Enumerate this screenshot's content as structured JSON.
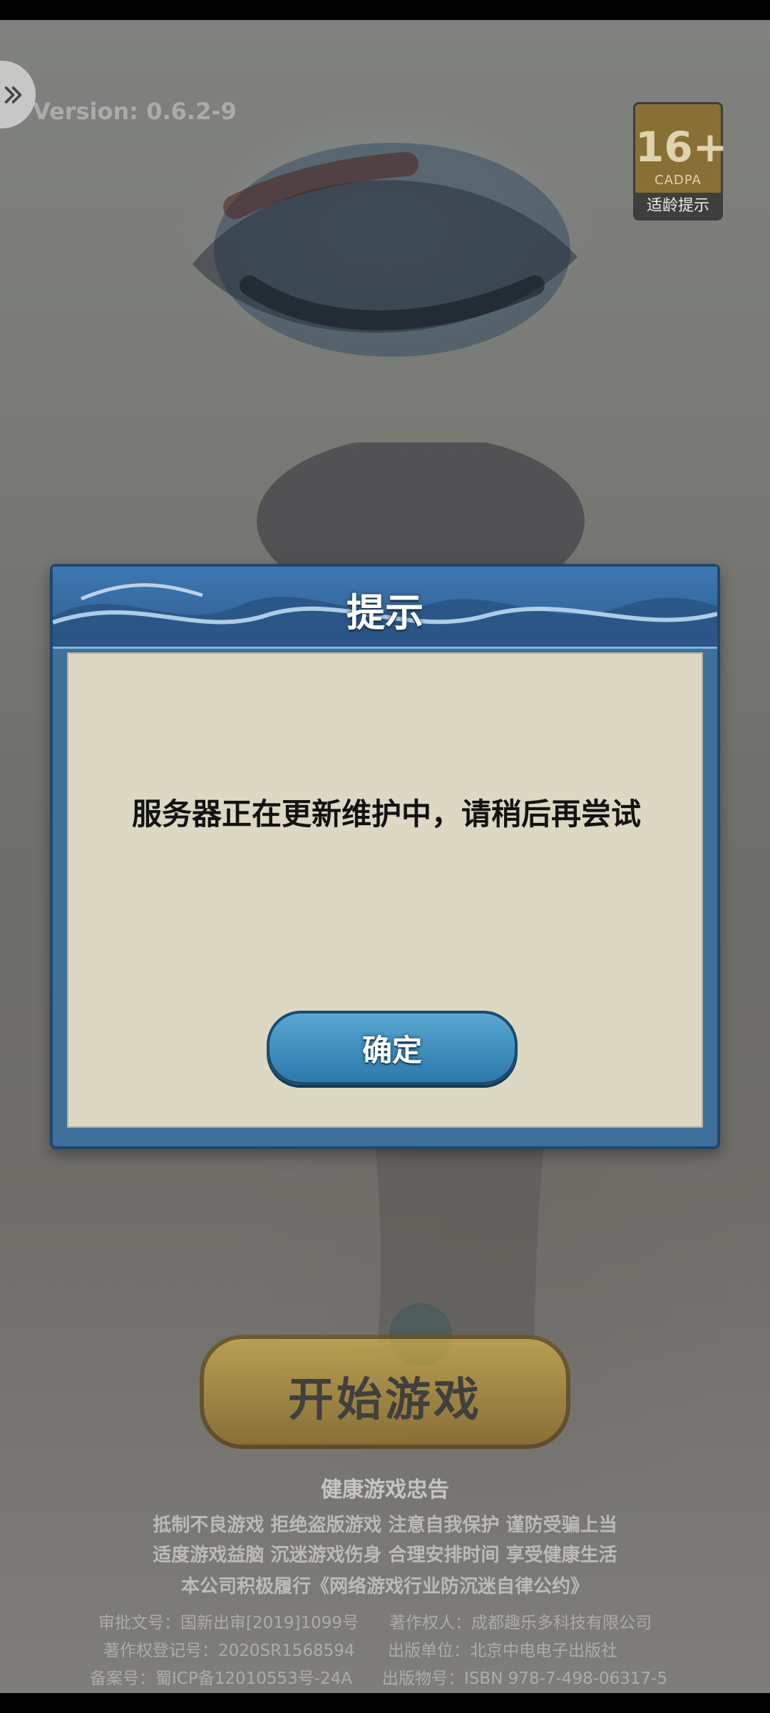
{
  "app": {
    "version": "Version: 0.6.2-9"
  },
  "age_badge": {
    "age": "16+",
    "org": "CADPA",
    "tip": "适龄提示"
  },
  "dialog": {
    "title": "提示",
    "message": "服务器正在更新维护中，请稍后再尝试",
    "ok_label": "确定"
  },
  "main": {
    "start_label": "开始游戏"
  },
  "footer": {
    "health_title": "健康游戏忠告",
    "health_lines": [
      "抵制不良游戏 拒绝盗版游戏 注意自我保护 谨防受骗上当",
      "适度游戏益脑 沉迷游戏伤身 合理安排时间 享受健康生活",
      "本公司积极履行《网络游戏行业防沉迷自律公约》"
    ],
    "legal": {
      "approval": "审批文号：国新出审[2019]1099号",
      "copyright_owner": "著作权人：成都趣乐多科技有限公司",
      "copyright_reg": "著作权登记号：2020SR1568594",
      "publisher": "出版单位：北京中电电子出版社",
      "icp": "备案号：蜀ICP备12010553号-24A",
      "isbn": "出版物号：ISBN 978-7-498-06317-5"
    }
  },
  "icons": {
    "back": "double-chevron-right-icon"
  },
  "colors": {
    "dialog_header": "#3e77b2",
    "dialog_body": "#dcd8c4",
    "ok_button": "#5aa7d3",
    "start_button": "#d8b54a"
  }
}
